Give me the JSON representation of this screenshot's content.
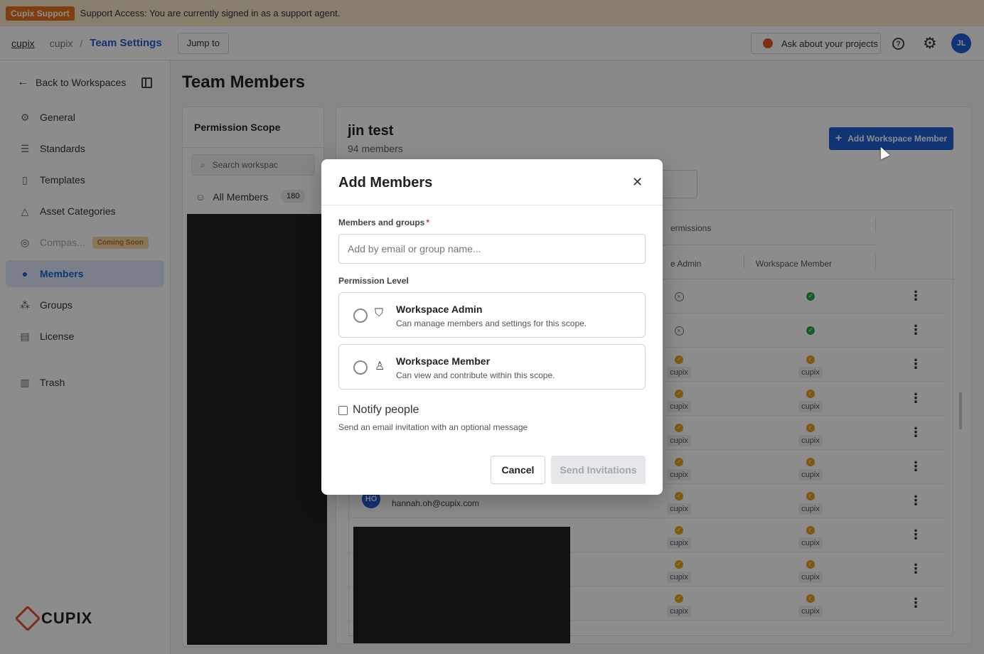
{
  "support": {
    "badge": "Cupix Support",
    "message": "Support Access: You are currently signed in as a support agent."
  },
  "header": {
    "org_link": "cupix",
    "crumb": "cupix",
    "separator": "/",
    "current": "Team Settings",
    "jump_label": "Jump to",
    "ask_label": "Ask about your projects",
    "avatar_initials": "JL"
  },
  "sidebar": {
    "back_label": "Back to Workspaces",
    "items": [
      {
        "label": "General",
        "icon": "gear-icon"
      },
      {
        "label": "Standards",
        "icon": "sliders-icon"
      },
      {
        "label": "Templates",
        "icon": "document-icon"
      },
      {
        "label": "Asset Categories",
        "icon": "shapes-icon"
      },
      {
        "label": "Compas...",
        "icon": "compass-icon",
        "badge": "Coming Soon"
      },
      {
        "label": "Members",
        "icon": "person-icon"
      },
      {
        "label": "Groups",
        "icon": "group-icon"
      },
      {
        "label": "License",
        "icon": "license-icon"
      },
      {
        "label": "Trash",
        "icon": "trash-icon"
      }
    ],
    "logo_text": "CUPIX"
  },
  "page": {
    "title": "Team Members"
  },
  "scope": {
    "title": "Permission Scope",
    "search_placeholder": "Search workspac",
    "all_members_label": "All Members",
    "all_members_count": "180"
  },
  "workspace": {
    "name": "jin test",
    "member_count": "94 members",
    "add_button": "Add Workspace Member"
  },
  "table": {
    "header_permissions": "ermissions",
    "col_admin": "e Admin",
    "col_member": "Workspace Member",
    "scope_tag": "cupix",
    "visible_email": "hannah.oh@cupix.com",
    "visible_initials": "HO"
  },
  "modal": {
    "title": "Add Members",
    "members_label": "Members and groups",
    "required_mark": "*",
    "members_placeholder": "Add by email or group name...",
    "permission_label": "Permission Level",
    "options": [
      {
        "title": "Workspace Admin",
        "desc": "Can manage members and settings for this scope."
      },
      {
        "title": "Workspace Member",
        "desc": "Can view and contribute within this scope."
      }
    ],
    "notify_label": "Notify people",
    "notify_desc": "Send an email invitation with an optional message",
    "cancel_label": "Cancel",
    "send_label": "Send Invitations"
  },
  "colors": {
    "accent": "#1f5fd6",
    "support_badge": "#e8711c",
    "status_green": "#2ba84a",
    "status_orange": "#e8a317"
  }
}
